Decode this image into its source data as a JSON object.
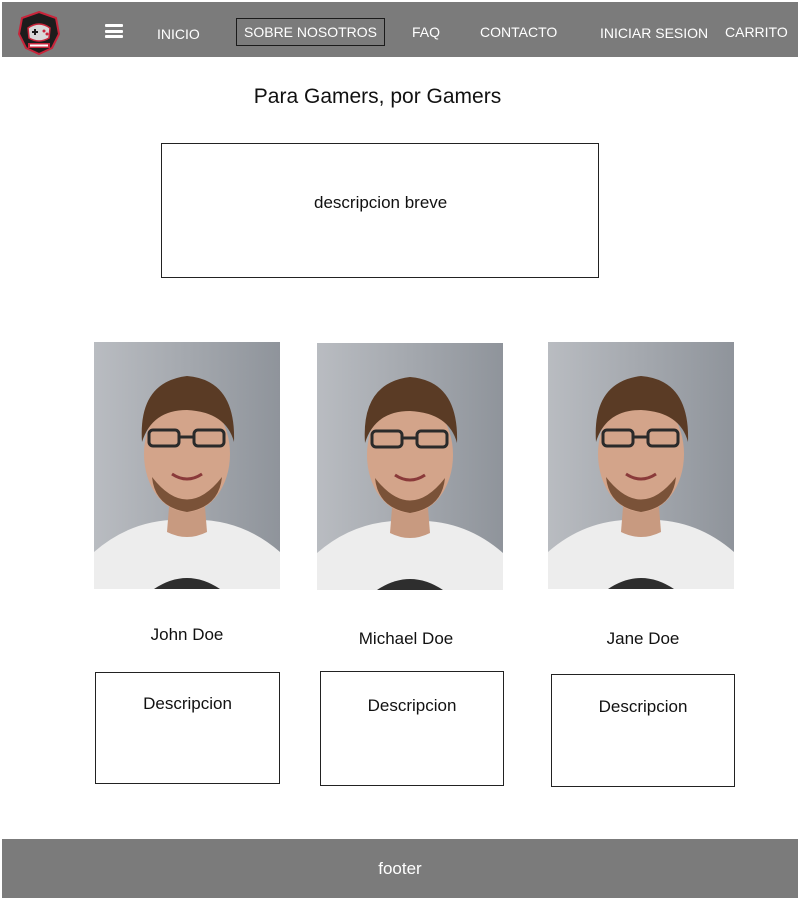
{
  "nav": {
    "items": [
      {
        "label": "INICIO"
      },
      {
        "label": "SOBRE NOSOTROS"
      },
      {
        "label": "FAQ"
      },
      {
        "label": "CONTACTO"
      },
      {
        "label": "INICIAR SESION"
      },
      {
        "label": "CARRITO"
      }
    ],
    "active": "SOBRE NOSOTROS",
    "icons": {
      "logo": "gamer-logo-icon",
      "menu": "hamburger-menu-icon"
    }
  },
  "main": {
    "title": "Para Gamers, por Gamers",
    "brief_description": "descripcion breve",
    "team": [
      {
        "name": "John Doe",
        "description": "Descripcion"
      },
      {
        "name": "Michael Doe",
        "description": "Descripcion"
      },
      {
        "name": "Jane Doe",
        "description": "Descripcion"
      }
    ]
  },
  "footer": {
    "label": "footer"
  },
  "colors": {
    "bar": "#7b7b7b",
    "nav_text": "#ffffff",
    "border": "#222222"
  }
}
